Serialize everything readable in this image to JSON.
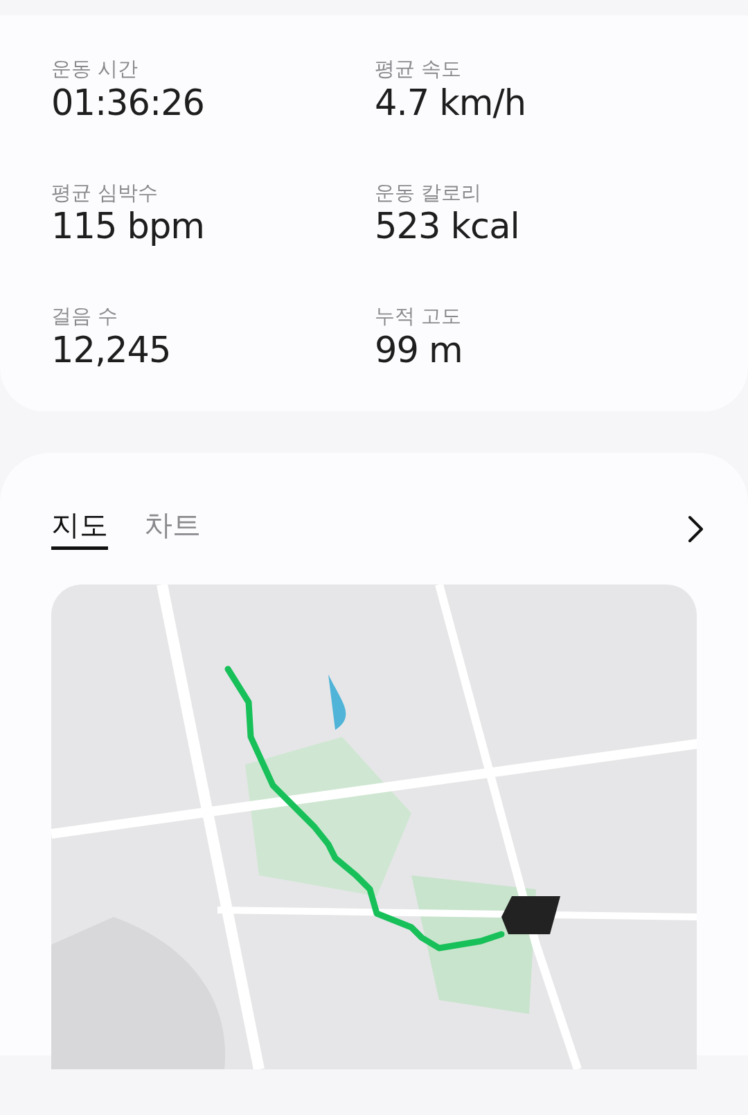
{
  "stats": [
    {
      "label": "운동 시간",
      "value": "01:36:26"
    },
    {
      "label": "평균 속도",
      "value": "4.7 km/h"
    },
    {
      "label": "평균 심박수",
      "value": "115 bpm"
    },
    {
      "label": "운동 칼로리",
      "value": "523 kcal"
    },
    {
      "label": "걸음 수",
      "value": "12,245"
    },
    {
      "label": "누적 고도",
      "value": "99 m"
    }
  ],
  "tabs": [
    {
      "label": "지도",
      "selected": true
    },
    {
      "label": "차트",
      "selected": false
    }
  ]
}
